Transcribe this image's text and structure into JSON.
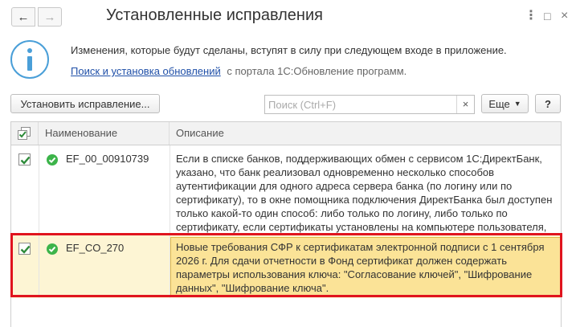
{
  "window": {
    "title": "Установленные исправления",
    "back_icon": "arrow-left-icon",
    "forward_icon": "arrow-right-icon"
  },
  "notice": {
    "text": "Изменения, которые будут сделаны, вступят в силу при следующем входе в приложение.",
    "link_text": "Поиск и установка обновлений",
    "link_suffix": "с портала 1С:Обновление программ.",
    "icon": "info-icon"
  },
  "toolbar": {
    "install_label": "Установить исправление...",
    "search_placeholder": "Поиск (Ctrl+F)",
    "search_value": "",
    "clear_label": "×",
    "more_label": "Еще",
    "help_label": "?"
  },
  "table": {
    "columns": [
      "",
      "Наименование",
      "Описание"
    ],
    "rows": [
      {
        "checked": true,
        "status": "installed",
        "name": "EF_00_00910739",
        "description": "Если в списке банков, поддерживающих обмен с сервисом 1С:ДиректБанк, указано, что банк реализовал одновременно несколько способов аутентификации для одного адреса сервера банка (по логину или по сертификату), то в окне помощника подключения ДиректБанка был доступен только какой-то один способ: либо только по логину, либо только по сертификату, если сертификаты установлены на компьютере пользователя, либо только по логину."
      },
      {
        "checked": true,
        "status": "installed",
        "name": "EF_CO_270",
        "description": "Новые требования СФР к сертификатам электронной подписи с 1 сентября 2026 г. Для сдачи отчетности в Фонд сертификат должен содержать параметры использования ключа: \"Согласование ключей\", \"Шифрование данных\", \"Шифрование ключа\".",
        "selected": true
      }
    ]
  },
  "colors": {
    "accent_blue": "#4a9fd8",
    "link": "#2050a8",
    "check_green": "#3cb44a",
    "row_selected": "#fdf5d4",
    "cell_selected": "#fbe397",
    "highlight_red": "#e0141e"
  }
}
